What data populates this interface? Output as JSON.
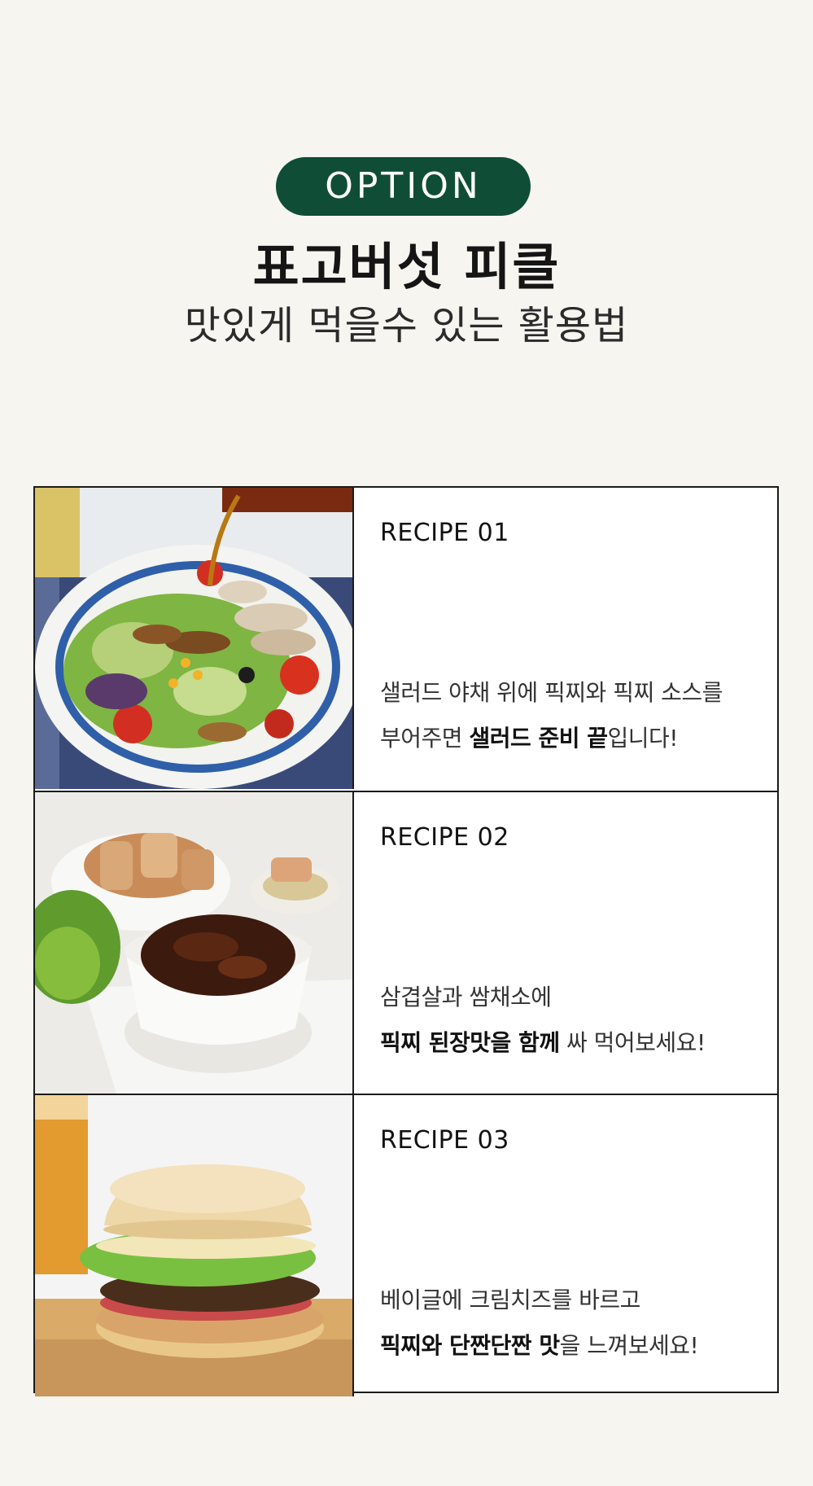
{
  "header": {
    "badge": "OPTION",
    "title": "표고버섯 피클",
    "subtitle": "맛있게 먹을수 있는 활용법"
  },
  "recipes": [
    {
      "label": "RECIPE 01",
      "line1": "샐러드 야채 위에 픽찌와 픽찌 소스를",
      "line2_pre": "부어주면 ",
      "line2_bold": "샐러드 준비 끝",
      "line2_post": "입니다!",
      "photo": "salad-photo"
    },
    {
      "label": "RECIPE 02",
      "line1": "삼겹살과 쌈채소에",
      "line2_bold": "픽찌 된장맛을 함께",
      "line2_post": " 싸 먹어보세요!",
      "photo": "pork-photo"
    },
    {
      "label": "RECIPE 03",
      "line1": "베이글에 크림치즈를 바르고",
      "line2_bold": "픽찌와 단짠단짠 맛",
      "line2_post": "을 느껴보세요!",
      "photo": "bagel-photo"
    }
  ],
  "colors": {
    "background": "#f7f5f0",
    "badge": "#0f4d37",
    "border": "#1b1b1b"
  }
}
